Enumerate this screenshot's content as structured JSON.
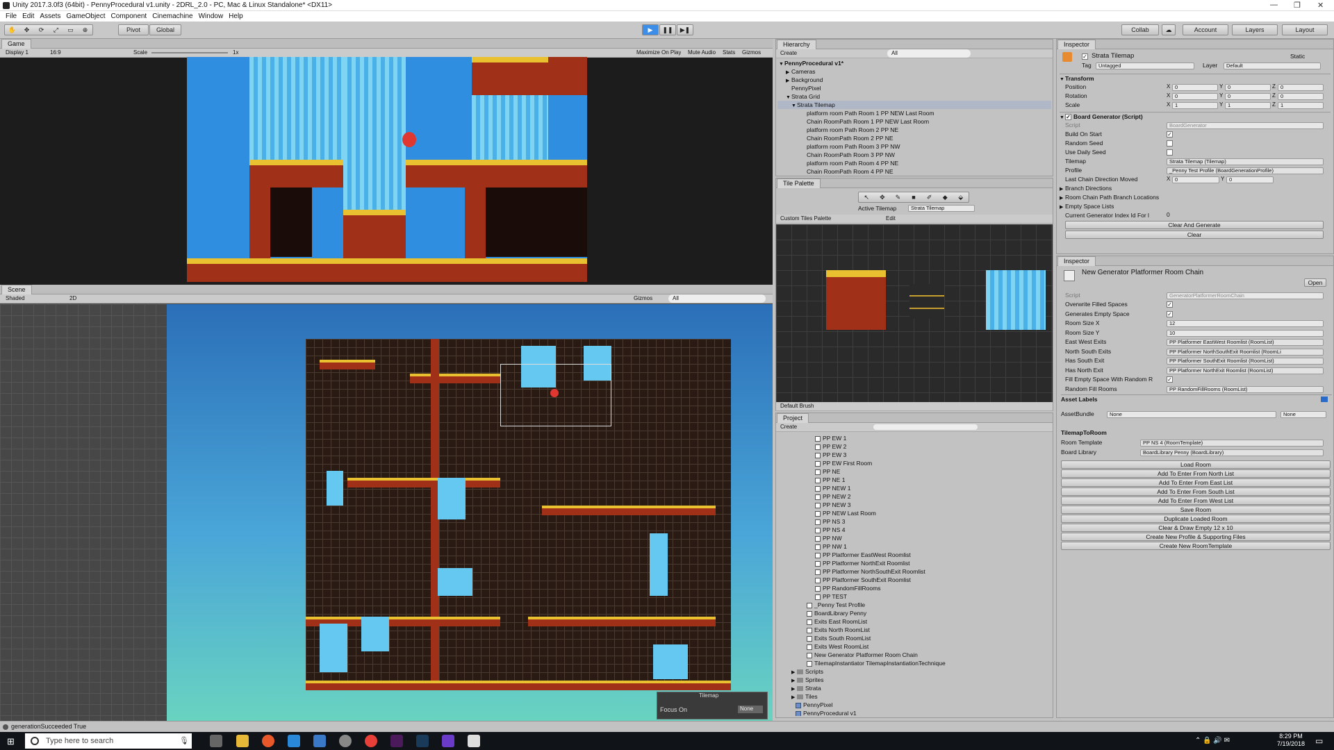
{
  "window": {
    "title": "Unity 2017.3.0f3 (64bit) - PennyProcedural v1.unity - 2DRL_2.0 - PC, Mac & Linux Standalone* <DX11>"
  },
  "menu": [
    "File",
    "Edit",
    "Assets",
    "GameObject",
    "Component",
    "Cinemachine",
    "Window",
    "Help"
  ],
  "toolbar": {
    "pivot": "Pivot",
    "global": "Global",
    "collab": "Collab",
    "account": "Account",
    "layers": "Layers",
    "layout": "Layout"
  },
  "game": {
    "tab": "Game",
    "display": "Display 1",
    "aspect": "16:9",
    "scale_label": "Scale",
    "scale_value": "1x",
    "maximize": "Maximize On Play",
    "mute": "Mute Audio",
    "stats": "Stats",
    "gizmos": "Gizmos"
  },
  "scene": {
    "tab": "Scene",
    "shading": "Shaded",
    "mode2d": "2D",
    "gizmos": "Gizmos",
    "search": "All",
    "tilemap_label": "Tilemap",
    "focus_on": "Focus On",
    "focus_value": "None"
  },
  "hierarchy": {
    "tab": "Hierarchy",
    "create": "Create",
    "search": "All",
    "scene_name": "PennyProcedural v1*",
    "items": [
      "Cameras",
      "Background",
      "PennyPixel",
      "Strata Grid",
      "Strata Tilemap",
      "platform room Path Room 1 PP NEW Last Room",
      "Chain RoomPath Room 1 PP NEW Last Room",
      "platform room Path Room 2 PP NE",
      "Chain RoomPath Room 2 PP NE",
      "platform room Path Room 3 PP NW",
      "Chain RoomPath Room 3 PP NW",
      "platform room Path Room 4 PP NE",
      "Chain RoomPath Room 4 PP NE"
    ]
  },
  "tile_palette": {
    "tab": "Tile Palette",
    "active_tilemap_label": "Active Tilemap",
    "active_tilemap_value": "Strata Tilemap",
    "palette_name": "Custom Tiles Palette",
    "edit": "Edit",
    "brush": "Default Brush"
  },
  "project": {
    "tab": "Project",
    "create": "Create",
    "items": [
      "PP EW 1",
      "PP EW 2",
      "PP EW 3",
      "PP EW First Room",
      "PP NE",
      "PP NE 1",
      "PP NEW 1",
      "PP NEW 2",
      "PP NEW 3",
      "PP NEW Last Room",
      "PP NS 3",
      "PP NS 4",
      "PP NW",
      "PP NW 1",
      "PP Platformer EastWest Roomlist",
      "PP Platformer NorthExit Roomlist",
      "PP Platformer NorthSouthExit Roomlist",
      "PP Platformer SouthExit Roomlist",
      "PP RandomFillRooms",
      "PP TEST",
      "_Penny Test Profile",
      "BoardLibrary Penny",
      "Exits East RoomList",
      "Exits North RoomList",
      "Exits South RoomList",
      "Exits West RoomList",
      "New Generator Platformer Room Chain",
      "TilemapInstantiator TilemapInstantiationTechnique",
      "Scripts",
      "Sprites",
      "Strata",
      "Tiles",
      "PennyPixel",
      "PennyProcedural v1"
    ]
  },
  "inspector1": {
    "tab": "Inspector",
    "object_name": "Strata Tilemap",
    "static": "Static",
    "tag_label": "Tag",
    "tag": "Untagged",
    "layer_label": "Layer",
    "layer": "Default",
    "transform": {
      "title": "Transform",
      "position": "Position",
      "rotation": "Rotation",
      "scale": "Scale",
      "pos": [
        "0",
        "0",
        "0"
      ],
      "rot": [
        "0",
        "0",
        "0"
      ],
      "scl": [
        "1",
        "1",
        "1"
      ]
    },
    "board": {
      "title": "Board Generator (Script)",
      "script_label": "Script",
      "script": "BoardGenerator",
      "build_on_start": "Build On Start",
      "random_seed": "Random Seed",
      "use_daily_seed": "Use Daily Seed",
      "tilemap_label": "Tilemap",
      "tilemap": "Strata Tilemap (Tilemap)",
      "profile_label": "Profile",
      "profile": "_Penny Test Profile (BoardGenerationProfile)",
      "last_chain": "Last Chain Direction Moved",
      "last_x": "0",
      "last_y": "0",
      "branch": "Branch Directions",
      "room_chain": "Room Chain Path Branch Locations",
      "empty_space": "Empty Space Lists",
      "current_gen": "Current Generator Index Id For l",
      "current_gen_val": "0",
      "clear_generate": "Clear And Generate",
      "clear": "Clear"
    }
  },
  "inspector2": {
    "tab": "Inspector",
    "object_name": "New Generator Platformer Room Chain",
    "open": "Open",
    "script_label": "Script",
    "script": "GeneratorPlatformerRoomChain",
    "rows": [
      {
        "label": "Overwrite Filled Spaces",
        "type": "check",
        "value": "✓"
      },
      {
        "label": "Generates Empty Space",
        "type": "check",
        "value": "✓"
      },
      {
        "label": "Room Size X",
        "type": "text",
        "value": "12"
      },
      {
        "label": "Room Size Y",
        "type": "text",
        "value": "10"
      },
      {
        "label": "East West Exits",
        "type": "obj",
        "value": "PP Platformer EastWest Roomlist (RoomList)"
      },
      {
        "label": "North South Exits",
        "type": "obj",
        "value": "PP Platformer NorthSouthExit Roomlist (RoomLi"
      },
      {
        "label": "Has South Exit",
        "type": "obj",
        "value": "PP Platformer SouthExit Roomlist (RoomList)"
      },
      {
        "label": "Has North Exit",
        "type": "obj",
        "value": "PP Platformer NorthExit Roomlist (RoomList)"
      },
      {
        "label": "Fill Empty Space With Random R",
        "type": "check",
        "value": "✓"
      },
      {
        "label": "Random Fill Rooms",
        "type": "obj",
        "value": "PP RandomFillRooms (RoomList)"
      }
    ],
    "asset_labels": "Asset Labels",
    "assetbundle_label": "AssetBundle",
    "assetbundle": "None",
    "assetbundle_variant": "None"
  },
  "tilemap_to_room": {
    "title": "TilemapToRoom",
    "room_template_label": "Room Template",
    "room_template": "PP NS 4 (RoomTemplate)",
    "board_library_label": "Board Library",
    "board_library": "BoardLibrary Penny (BoardLibrary)",
    "buttons": [
      "Load Room",
      "Add To Enter From North List",
      "Add To Enter From East List",
      "Add To Enter From South List",
      "Add To Enter From West List",
      "Save Room",
      "Duplicate Loaded Room",
      "Clear & Draw Empty 12 x 10",
      "Create New Profile & Supporting Files",
      "Create New RoomTemplate"
    ]
  },
  "status": "generationSucceeded True",
  "taskbar": {
    "search": "Type here to search",
    "time": "8:29 PM",
    "date": "7/19/2018"
  },
  "colors": {
    "sky": "#2f8ee0",
    "water": "#64c8f0",
    "rock": "#a03018",
    "grass": "#e8c030",
    "scene_top": "#2b6fb8",
    "scene_bottom": "#6ad4c0"
  }
}
